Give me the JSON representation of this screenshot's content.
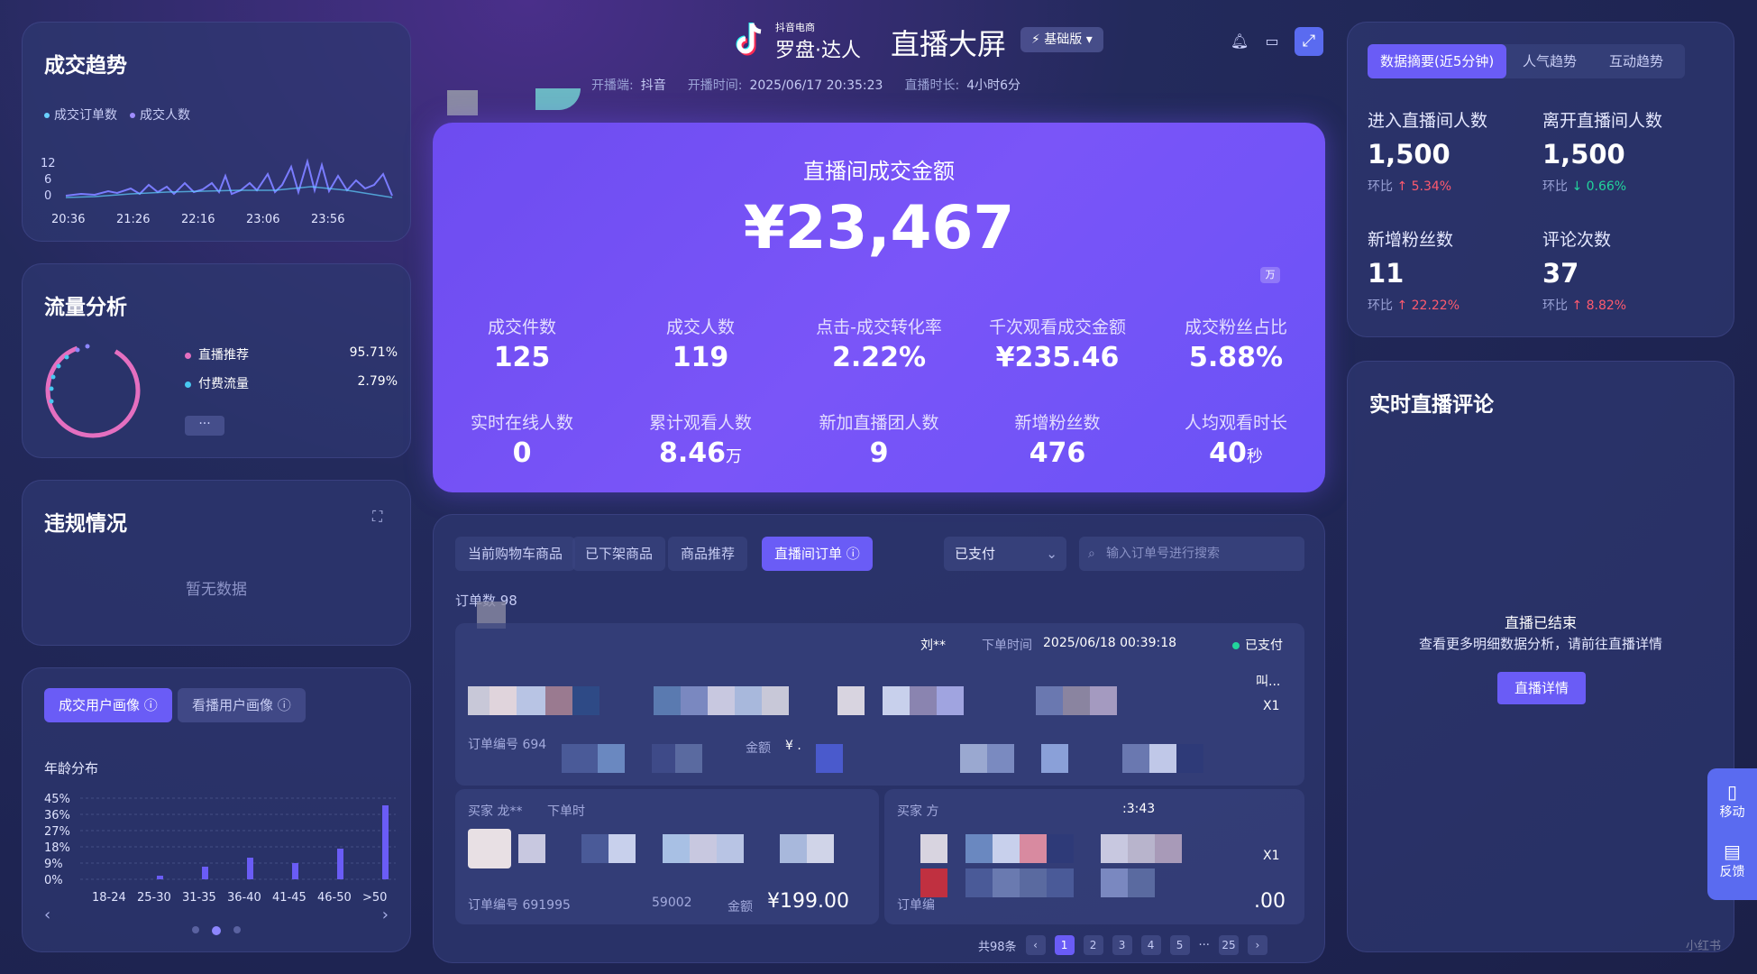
{
  "header": {
    "brand_small": "抖音电商",
    "brand_large": "罗盘·达人",
    "screen_title": "直播大屏",
    "version": "基础版",
    "meta": {
      "platform_label": "开播端:",
      "platform_value": "抖音",
      "start_label": "开播时间:",
      "start_value": "2025/06/17 20:35:23",
      "duration_label": "直播时长:",
      "duration_value": "4小时6分"
    }
  },
  "trend": {
    "title": "成交趋势",
    "legend": [
      "成交订单数",
      "成交人数"
    ],
    "y_ticks": [
      "12",
      "6",
      "0"
    ],
    "x_ticks": [
      "20:36",
      "21:26",
      "22:16",
      "23:06",
      "23:56"
    ]
  },
  "traffic": {
    "title": "流量分析",
    "items": [
      {
        "label": "直播推荐",
        "value": "95.71%",
        "color": "#e46fc0"
      },
      {
        "label": "付费流量",
        "value": "2.79%",
        "color": "#48c8f0"
      }
    ],
    "more": "···"
  },
  "violation": {
    "title": "违规情况",
    "empty": "暂无数据"
  },
  "portrait": {
    "tabs": [
      "成交用户画像",
      "看播用户画像"
    ],
    "age_title": "年龄分布",
    "chart_data": {
      "type": "bar",
      "categories": [
        "18-24",
        "25-30",
        "31-35",
        "36-40",
        "41-45",
        "46-50",
        ">50"
      ],
      "values": [
        0,
        2,
        7,
        12,
        9,
        17,
        41
      ],
      "y_ticks": [
        "45%",
        "36%",
        "27%",
        "18%",
        "9%",
        "0%"
      ],
      "ylim": [
        0,
        45
      ]
    }
  },
  "hero": {
    "title": "直播间成交金额",
    "value": "¥23,467",
    "unit": "万",
    "stats": [
      {
        "label": "成交件数",
        "value": "125",
        "unit": ""
      },
      {
        "label": "成交人数",
        "value": "119",
        "unit": ""
      },
      {
        "label": "点击-成交转化率",
        "value": "2.22%",
        "unit": ""
      },
      {
        "label": "千次观看成交金额",
        "value": "¥235.46",
        "unit": ""
      },
      {
        "label": "成交粉丝占比",
        "value": "5.88%",
        "unit": ""
      },
      {
        "label": "实时在线人数",
        "value": "0",
        "unit": ""
      },
      {
        "label": "累计观看人数",
        "value": "8.46",
        "unit": "万"
      },
      {
        "label": "新加直播团人数",
        "value": "9",
        "unit": ""
      },
      {
        "label": "新增粉丝数",
        "value": "476",
        "unit": ""
      },
      {
        "label": "人均观看时长",
        "value": "40",
        "unit": "秒"
      }
    ]
  },
  "orders": {
    "tabs": [
      "当前购物车商品",
      "已下架商品",
      "商品推荐",
      "直播间订单 ⓘ"
    ],
    "status_select": "已支付",
    "search_placeholder": "输入订单号进行搜索",
    "count_label": "订单数 98",
    "card1": {
      "buyer": "刘**",
      "time_label": "下单时间",
      "time": "2025/06/18 00:39:18",
      "status": "已支付",
      "order_no_label": "订单编号 694",
      "amount_label": "金额",
      "amount_prefix": "¥ .",
      "qty": "X1",
      "name_frag": "叫..."
    },
    "card2": {
      "buyer": "买家  龙**",
      "time_label": "下单时",
      "order_no_label": "订单编号 691995",
      "order_no_tail": "59002",
      "amount_label": "金额",
      "amount": "¥199.00"
    },
    "card3": {
      "buyer": "买家  方",
      "time": ":3:43",
      "order_no_label": "订单编",
      "amount": ".00",
      "qty": "X1"
    },
    "pagination": {
      "total": "共98条",
      "pages": [
        "1",
        "2",
        "3",
        "4",
        "5",
        "···",
        "25"
      ],
      "current": "1"
    }
  },
  "summary": {
    "tabs": [
      "数据摘要(近5分钟)",
      "人气趋势",
      "互动趋势"
    ],
    "kpis": [
      {
        "label": "进入直播间人数",
        "value": "1,500",
        "cmp": "环比",
        "delta": "↑ 5.34%",
        "dir": "up"
      },
      {
        "label": "离开直播间人数",
        "value": "1,500",
        "cmp": "环比",
        "delta": "↓ 0.66%",
        "dir": "down"
      },
      {
        "label": "新增粉丝数",
        "value": "11",
        "cmp": "环比",
        "delta": "↑ 22.22%",
        "dir": "up"
      },
      {
        "label": "评论次数",
        "value": "37",
        "cmp": "环比",
        "delta": "↑ 8.82%",
        "dir": "up"
      }
    ]
  },
  "comments": {
    "title": "实时直播评论",
    "end_title": "直播已结束",
    "end_sub": "查看更多明细数据分析，请前往直播详情",
    "detail_button": "直播详情"
  },
  "side_float": {
    "mobile": "移动",
    "feedback": "反馈"
  },
  "watermark": "小红书"
}
